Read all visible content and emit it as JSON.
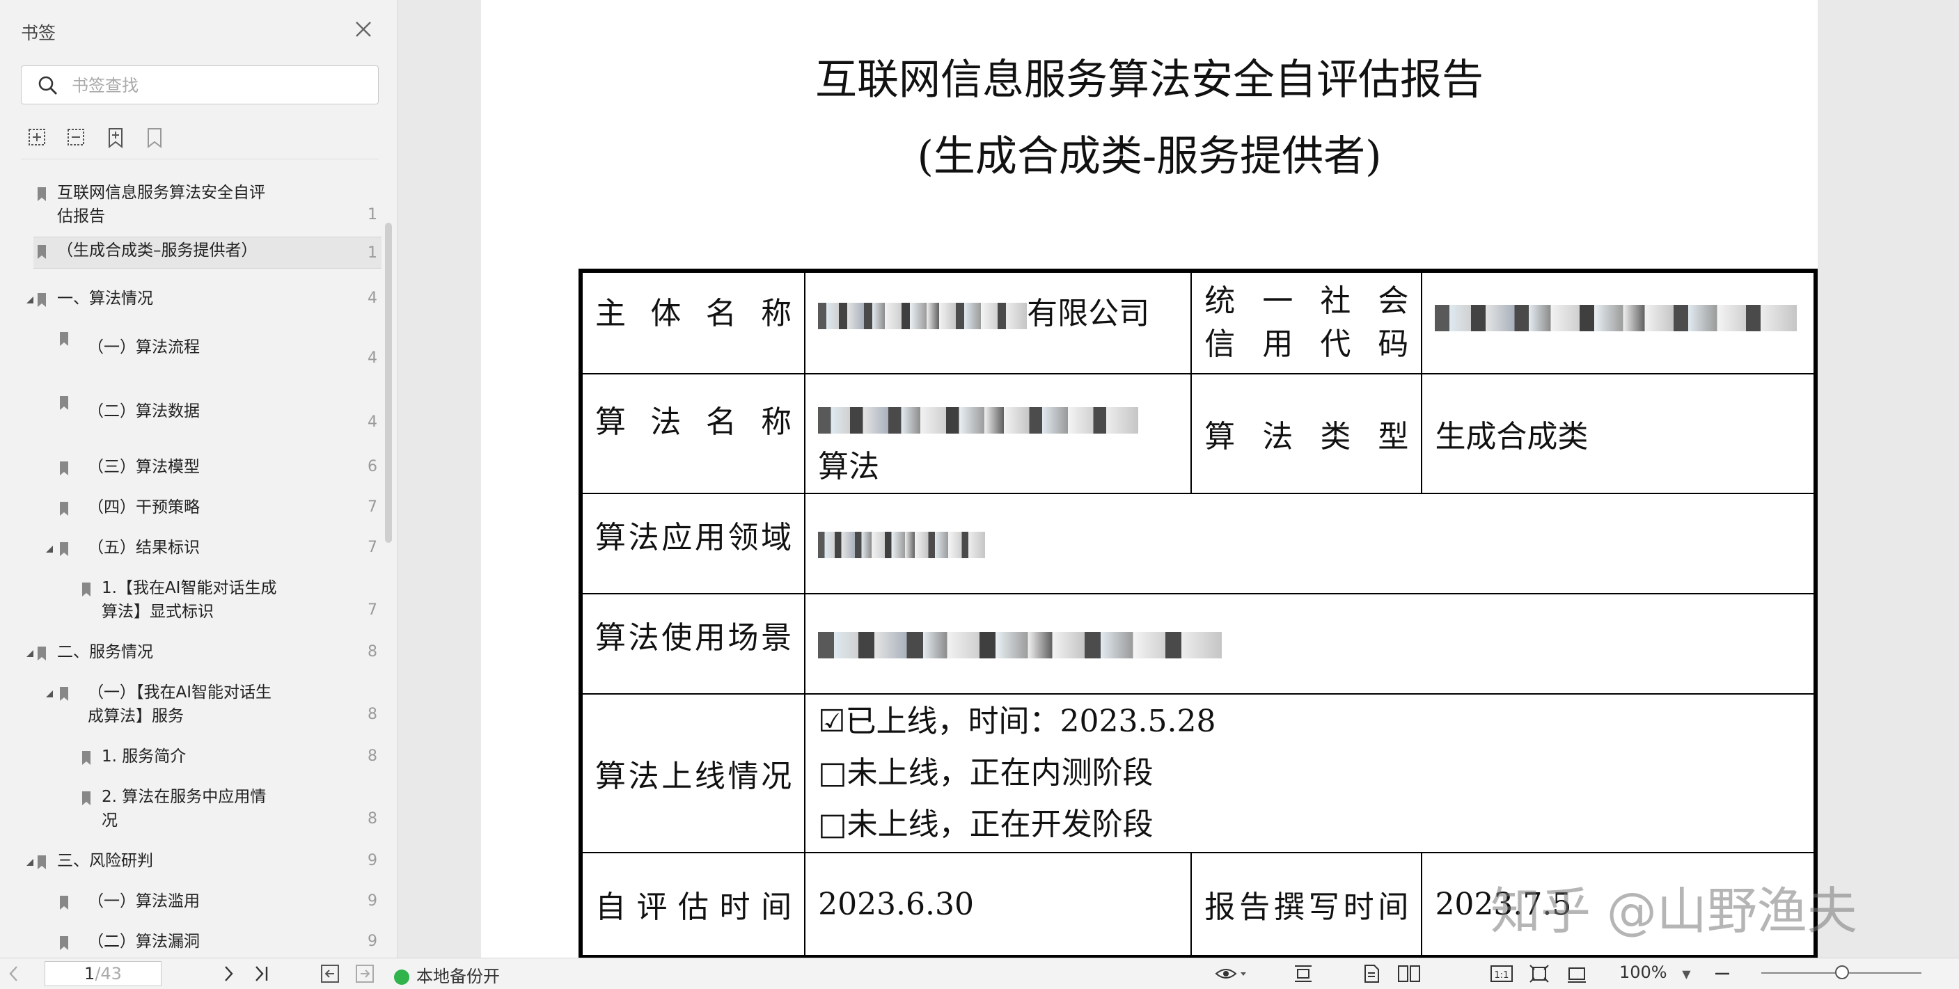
{
  "sidebar": {
    "title": "书签",
    "search": {
      "placeholder": "书签查找",
      "value": ""
    },
    "tools": [
      "expand-all-icon",
      "collapse-all-icon",
      "add-bookmark-icon",
      "remove-bookmark-icon"
    ],
    "items": [
      {
        "label1": "互联网信息服务算法安全自评",
        "label2": "估报告",
        "page": "1"
      },
      {
        "label1": "（生成合成类–服务提供者）",
        "page": "1"
      },
      {
        "label1": "一、算法情况",
        "page": "4"
      },
      {
        "label1": "（一）算法流程",
        "page": "4"
      },
      {
        "label1": "（二）算法数据",
        "page": "4"
      },
      {
        "label1": "（三）算法模型",
        "page": "6"
      },
      {
        "label1": "（四）干预策略",
        "page": "7"
      },
      {
        "label1": "（五）结果标识",
        "page": "7"
      },
      {
        "label1": "1.【我在AI智能对话生成",
        "label2": "算法】显式标识",
        "page": "7"
      },
      {
        "label1": "二、服务情况",
        "page": "8"
      },
      {
        "label1": "（一）【我在AI智能对话生",
        "label2": "成算法】服务",
        "page": "8"
      },
      {
        "label1": "1.  服务简介",
        "page": "8"
      },
      {
        "label1": "2.  算法在服务中应用情",
        "label2": "况",
        "page": "8"
      },
      {
        "label1": "三、风险研判",
        "page": "9"
      },
      {
        "label1": "（一）算法滥用",
        "page": "9"
      },
      {
        "label1": "（二）算法漏洞",
        "page": "9"
      }
    ]
  },
  "document": {
    "title": "互联网信息服务算法安全自评估报告",
    "subtitle": "(生成合成类-服务提供者)",
    "rows": {
      "subject_label": "主体名称",
      "subject_value_suffix": "有限公司",
      "credit_code_label_1": "统 一 社 会",
      "credit_code_label_2": "信 用 代 码",
      "algo_name_label": "算法名称",
      "algo_name_value_suffix": "算法",
      "algo_type_label": "算法类型",
      "algo_type_value": "生成合成类",
      "domain_label": "算法应用领域",
      "scenario_label": "算法使用场景",
      "online_label": "算法上线情况",
      "online_opt1": "☑已上线，时间：2023.5.28",
      "online_opt2": "□未上线，正在内测阶段",
      "online_opt3": "□未上线，正在开发阶段",
      "eval_time_label": "自评估时间",
      "eval_time_value": "2023.6.30",
      "report_time_label": "报告撰写时间",
      "report_time_value": "2023.7.5"
    },
    "watermark": "知乎 @山野渔夫"
  },
  "statusbar": {
    "current_page": "1",
    "total_pages": "/43",
    "backup_label": "本地备份开",
    "zoom": "100%"
  },
  "colors": {
    "backup_green": "#2fb34a",
    "sidebar_bg": "#f2f2f2",
    "doc_bg": "#e9e9e9"
  }
}
